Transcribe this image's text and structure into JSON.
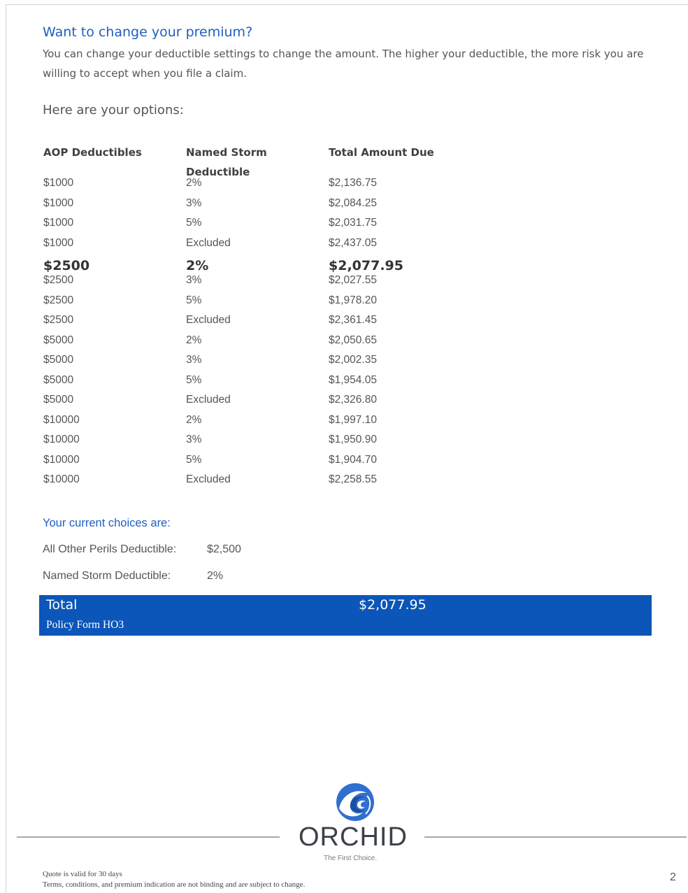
{
  "heading": "Want to change your premium?",
  "intro": "You can change your deductible settings to change the amount. The higher your deductible, the more risk you are willing to accept when you file a claim.",
  "options_title": "Here are your options:",
  "table": {
    "headers": [
      "AOP Deductibles",
      "Named Storm Deductible",
      "Total Amount Due"
    ],
    "rows": [
      {
        "aop": "$1000",
        "storm": "2%",
        "total": "$2,136.75",
        "selected": false
      },
      {
        "aop": "$1000",
        "storm": "3%",
        "total": "$2,084.25",
        "selected": false
      },
      {
        "aop": "$1000",
        "storm": "5%",
        "total": "$2,031.75",
        "selected": false
      },
      {
        "aop": "$1000",
        "storm": "Excluded",
        "total": "$2,437.05",
        "selected": false
      },
      {
        "aop": "$2500",
        "storm": "2%",
        "total": "$2,077.95",
        "selected": true
      },
      {
        "aop": "$2500",
        "storm": "3%",
        "total": "$2,027.55",
        "selected": false
      },
      {
        "aop": "$2500",
        "storm": "5%",
        "total": "$1,978.20",
        "selected": false
      },
      {
        "aop": "$2500",
        "storm": "Excluded",
        "total": "$2,361.45",
        "selected": false
      },
      {
        "aop": "$5000",
        "storm": "2%",
        "total": "$2,050.65",
        "selected": false
      },
      {
        "aop": "$5000",
        "storm": "3%",
        "total": "$2,002.35",
        "selected": false
      },
      {
        "aop": "$5000",
        "storm": "5%",
        "total": "$1,954.05",
        "selected": false
      },
      {
        "aop": "$5000",
        "storm": "Excluded",
        "total": "$2,326.80",
        "selected": false
      },
      {
        "aop": "$10000",
        "storm": "2%",
        "total": "$1,997.10",
        "selected": false
      },
      {
        "aop": "$10000",
        "storm": "3%",
        "total": "$1,950.90",
        "selected": false
      },
      {
        "aop": "$10000",
        "storm": "5%",
        "total": "$1,904.70",
        "selected": false
      },
      {
        "aop": "$10000",
        "storm": "Excluded",
        "total": "$2,258.55",
        "selected": false
      }
    ]
  },
  "current": {
    "title": "Your current choices are:",
    "aop_label": "All Other Perils Deductible:",
    "aop_value": "$2,500",
    "storm_label": "Named Storm Deductible:",
    "storm_value": "2%"
  },
  "total_bar": {
    "label": "Total",
    "amount": "$2,077.95",
    "policy_form": "Policy Form HO3",
    "color": "#0b56b8"
  },
  "logo": {
    "name": "ORCHID",
    "tagline": "The First Choice.",
    "icon": "wave-logo-icon"
  },
  "footer": {
    "line1": "Quote is valid for 30 days",
    "line2": "Terms, conditions, and premium indication are not binding and are subject to change.",
    "page_number": "2"
  }
}
